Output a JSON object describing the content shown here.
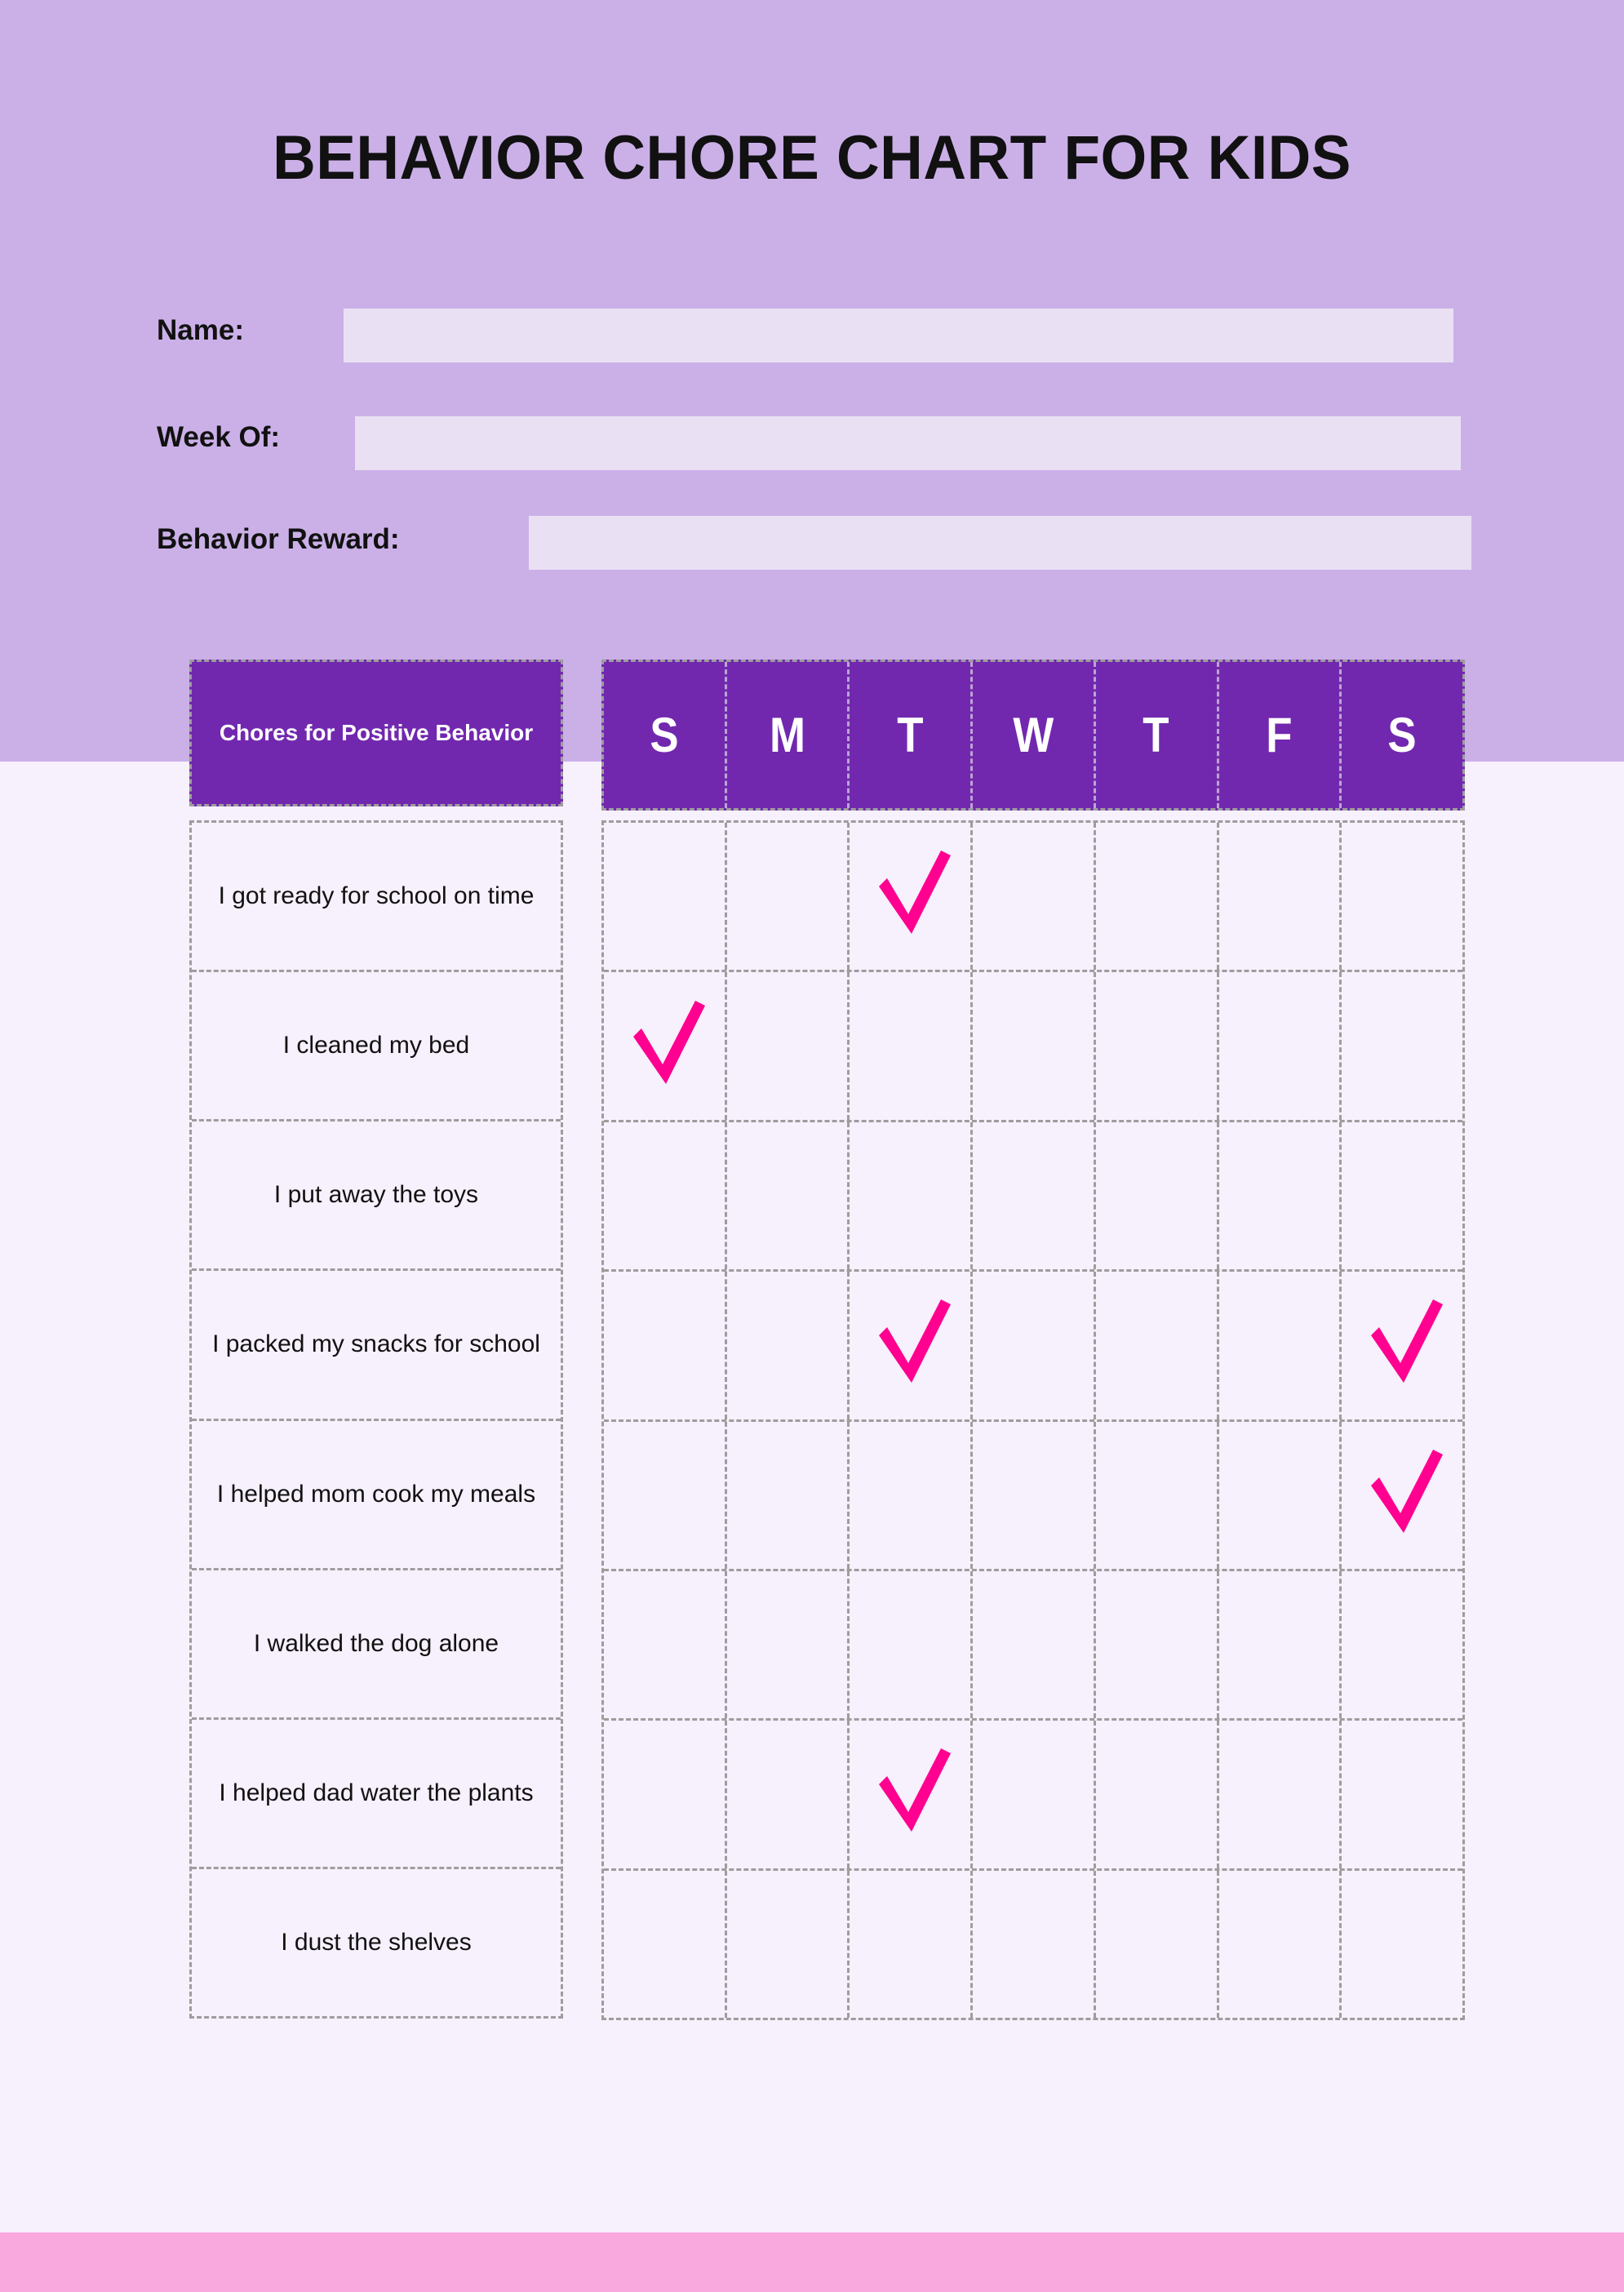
{
  "page": {
    "title": "BEHAVIOR CHORE CHART FOR KIDS",
    "accent_purple": "#7128AE",
    "lavender": "#CBB0E8",
    "body_background": "#F7F0FD",
    "field_fill": "#EAE0F3",
    "pink_band": "#FAA9DF",
    "check_color": "#FF0090",
    "grid_line": "#9D9D9D"
  },
  "form": {
    "fields": [
      {
        "label": "Name:",
        "value": "",
        "placeholder": ""
      },
      {
        "label": "Week Of:",
        "value": "",
        "placeholder": ""
      },
      {
        "label": "Behavior Reward:",
        "value": "",
        "placeholder": ""
      }
    ]
  },
  "table": {
    "chores_header": "Chores for Positive Behavior",
    "days": [
      "S",
      "M",
      "T",
      "W",
      "T",
      "F",
      "S"
    ],
    "rows": [
      {
        "chore": "I got ready for school on time",
        "checks": [
          false,
          false,
          true,
          false,
          false,
          false,
          false
        ]
      },
      {
        "chore": "I cleaned my bed",
        "checks": [
          true,
          false,
          false,
          false,
          false,
          false,
          false
        ]
      },
      {
        "chore": "I put away the toys",
        "checks": [
          false,
          false,
          false,
          false,
          false,
          false,
          false
        ]
      },
      {
        "chore": "I packed my snacks for school",
        "checks": [
          false,
          false,
          true,
          false,
          false,
          false,
          true
        ]
      },
      {
        "chore": "I helped mom cook my meals",
        "checks": [
          false,
          false,
          false,
          false,
          false,
          false,
          true
        ]
      },
      {
        "chore": "I walked the dog alone",
        "checks": [
          false,
          false,
          false,
          false,
          false,
          false,
          false
        ]
      },
      {
        "chore": "I helped dad water the plants",
        "checks": [
          false,
          false,
          true,
          false,
          false,
          false,
          false
        ]
      },
      {
        "chore": "I dust the shelves",
        "checks": [
          false,
          false,
          false,
          false,
          false,
          false,
          false
        ]
      }
    ]
  }
}
